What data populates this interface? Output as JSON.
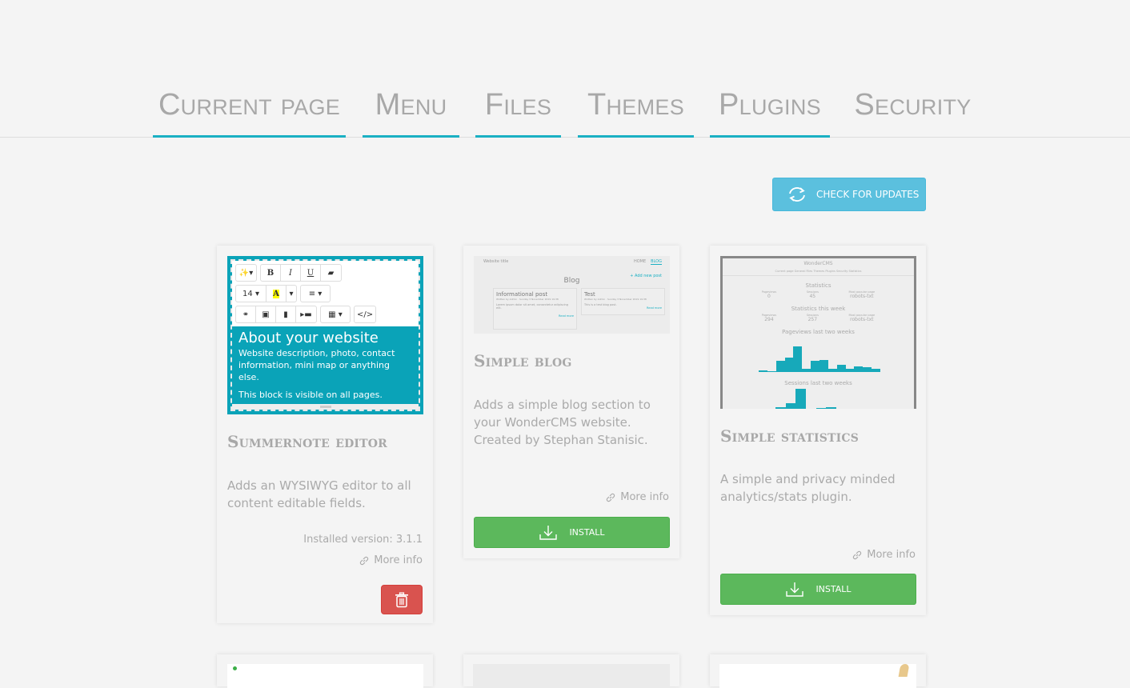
{
  "tabs": [
    {
      "label": "Current page",
      "active": false
    },
    {
      "label": "Menu",
      "active": false
    },
    {
      "label": "Files",
      "active": false
    },
    {
      "label": "Themes",
      "active": false
    },
    {
      "label": "Plugins",
      "active": true
    },
    {
      "label": "Security",
      "active": false
    }
  ],
  "check_updates": {
    "label": "CHECK FOR UPDATES",
    "icon": "refresh-icon"
  },
  "plugins": [
    {
      "name": "Summernote editor",
      "description": "Adds an WYSIWYG editor to all content editable fields.",
      "installed_version": "Installed version: 3.1.1",
      "more_info": "More info",
      "action": "delete",
      "thumbnail": {
        "font_size": "14",
        "heading": "About your website",
        "line1": "Website description, photo, contact information, mini map or anything else.",
        "line2": "This block is visible on all pages."
      }
    },
    {
      "name": "Simple blog",
      "description": "Adds a simple blog section to your WonderCMS website. Created by Stephan Stanisic.",
      "more_info": "More info",
      "action": "install",
      "install_label": "INSTALL",
      "thumbnail": {
        "site_title": "Website title",
        "nav": [
          "HOME",
          "BLOG"
        ],
        "title": "Blog",
        "add": "+ Add new post",
        "posts": [
          {
            "title": "Informational post",
            "meta": "Written by Admin · Sunday 3 November 2019 19:38",
            "body": "Lorem ipsum dolor sit amet, consectetur adipiscing elit.",
            "read_more": "Read more"
          },
          {
            "title": "Test",
            "meta": "Written by Admin · Sunday 3 November 2019 19:38",
            "body": "This is a test blog post.",
            "read_more": "Read more"
          }
        ]
      }
    },
    {
      "name": "Simple statistics",
      "description": "A simple and privacy minded analytics/stats plugin.",
      "more_info": "More info",
      "action": "install",
      "install_label": "INSTALL",
      "thumbnail": {
        "title": "WonderCMS",
        "nav": "Current page   General   Files   Themes   Plugins   Security   Statistics",
        "stats_heading": "Statistics",
        "stats": [
          {
            "label": "Pageviews",
            "value": "0"
          },
          {
            "label": "Sessions",
            "value": "45"
          },
          {
            "label": "Most popular page",
            "value": "robots-txt"
          }
        ],
        "week_heading": "Statistics this week",
        "week": [
          {
            "label": "Pageviews",
            "value": "294"
          },
          {
            "label": "Sessions",
            "value": "257"
          },
          {
            "label": "Most popular page",
            "value": "robots-txt"
          }
        ],
        "pageviews_heading": "Pageviews last two weeks",
        "pageviews": [
          6,
          2,
          40,
          50,
          90,
          12,
          40,
          42,
          10,
          26,
          10,
          20,
          17,
          11
        ],
        "sessions_heading": "Sessions last two weeks",
        "sessions": [
          10,
          20,
          55,
          0,
          8,
          10
        ]
      }
    }
  ]
}
